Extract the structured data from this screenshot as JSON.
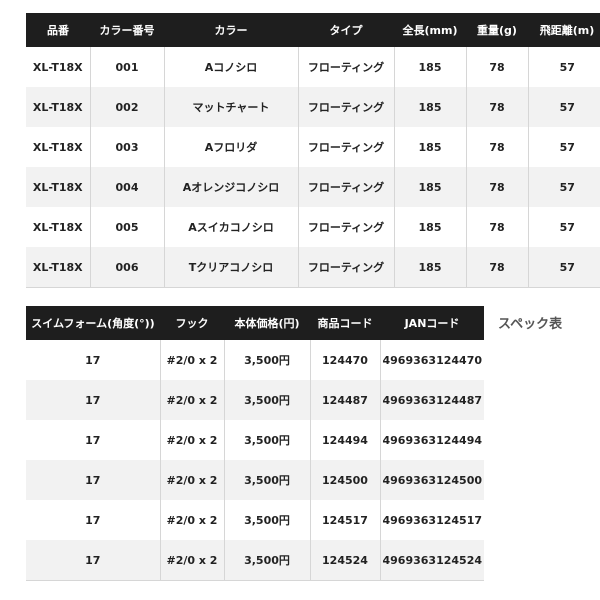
{
  "spec_table_1": {
    "headers": [
      "品番",
      "カラー番号",
      "カラー",
      "タイプ",
      "全長(mm)",
      "重量(g)",
      "飛距離(m)"
    ],
    "rows": [
      [
        "XL-T18X",
        "001",
        "Aコノシロ",
        "フローティング",
        "185",
        "78",
        "57"
      ],
      [
        "XL-T18X",
        "002",
        "マットチャート",
        "フローティング",
        "185",
        "78",
        "57"
      ],
      [
        "XL-T18X",
        "003",
        "Aフロリダ",
        "フローティング",
        "185",
        "78",
        "57"
      ],
      [
        "XL-T18X",
        "004",
        "Aオレンジコノシロ",
        "フローティング",
        "185",
        "78",
        "57"
      ],
      [
        "XL-T18X",
        "005",
        "Aスイカコノシロ",
        "フローティング",
        "185",
        "78",
        "57"
      ],
      [
        "XL-T18X",
        "006",
        "Tクリアコノシロ",
        "フローティング",
        "185",
        "78",
        "57"
      ]
    ]
  },
  "spec_table_2": {
    "headers": [
      "スイムフォーム(角度(°))",
      "フック",
      "本体価格(円)",
      "商品コード",
      "JANコード"
    ],
    "rows": [
      [
        "17",
        "#2/0 x 2",
        "3,500円",
        "124470",
        "4969363124470"
      ],
      [
        "17",
        "#2/0 x 2",
        "3,500円",
        "124487",
        "4969363124487"
      ],
      [
        "17",
        "#2/0 x 2",
        "3,500円",
        "124494",
        "4969363124494"
      ],
      [
        "17",
        "#2/0 x 2",
        "3,500円",
        "124500",
        "4969363124500"
      ],
      [
        "17",
        "#2/0 x 2",
        "3,500円",
        "124517",
        "4969363124517"
      ],
      [
        "17",
        "#2/0 x 2",
        "3,500円",
        "124524",
        "4969363124524"
      ]
    ]
  },
  "caption": "スペック表",
  "colors": {
    "header_bg": "#1e1e1e",
    "header_text": "#ffffff",
    "stripe": "#f2f2f2"
  }
}
